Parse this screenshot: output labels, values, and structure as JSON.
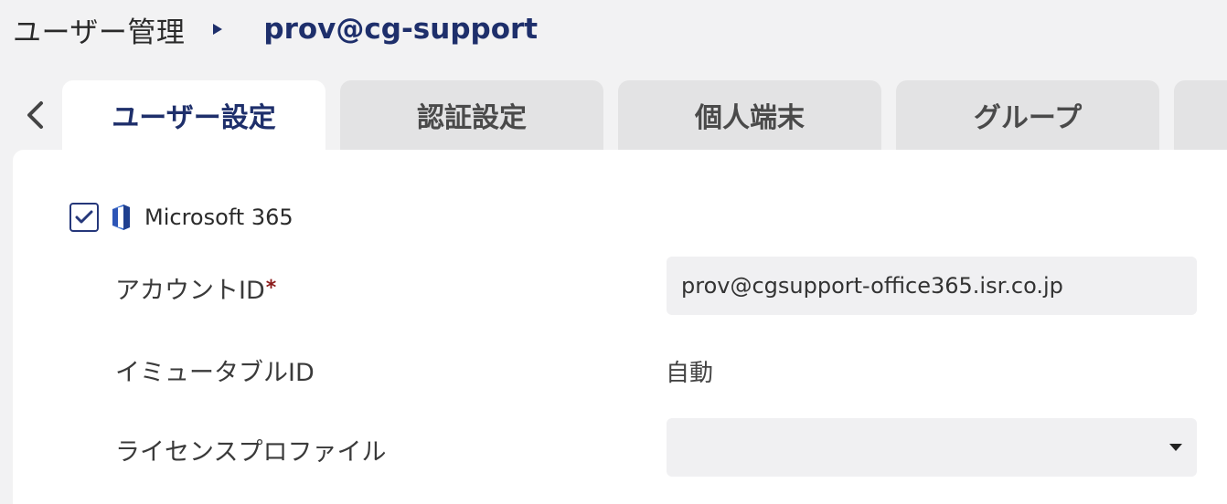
{
  "breadcrumb": {
    "root": "ユーザー管理",
    "separator_icon": "triangle-right-icon",
    "current": "prov@cg-support"
  },
  "tabs": {
    "prev_icon": "chevron-left-icon",
    "items": [
      {
        "label": "ユーザー設定",
        "active": true
      },
      {
        "label": "認証設定",
        "active": false
      },
      {
        "label": "個人端末",
        "active": false
      },
      {
        "label": "グループ",
        "active": false
      }
    ]
  },
  "service": {
    "checked": true,
    "icon": "office-icon",
    "name": "Microsoft 365"
  },
  "form": {
    "account_id": {
      "label": "アカウントID",
      "required_mark": "*",
      "value": "prov@cgsupport-office365.isr.co.jp"
    },
    "immutable_id": {
      "label": "イミュータブルID",
      "value": "自動"
    },
    "license_profile": {
      "label": "ライセンスプロファイル",
      "value": ""
    }
  },
  "colors": {
    "accent": "#1e2f6b",
    "tab_inactive": "#e3e3e4",
    "background": "#f2f2f3",
    "field_bg": "#f0f0f2",
    "required": "#8b1a1a"
  }
}
